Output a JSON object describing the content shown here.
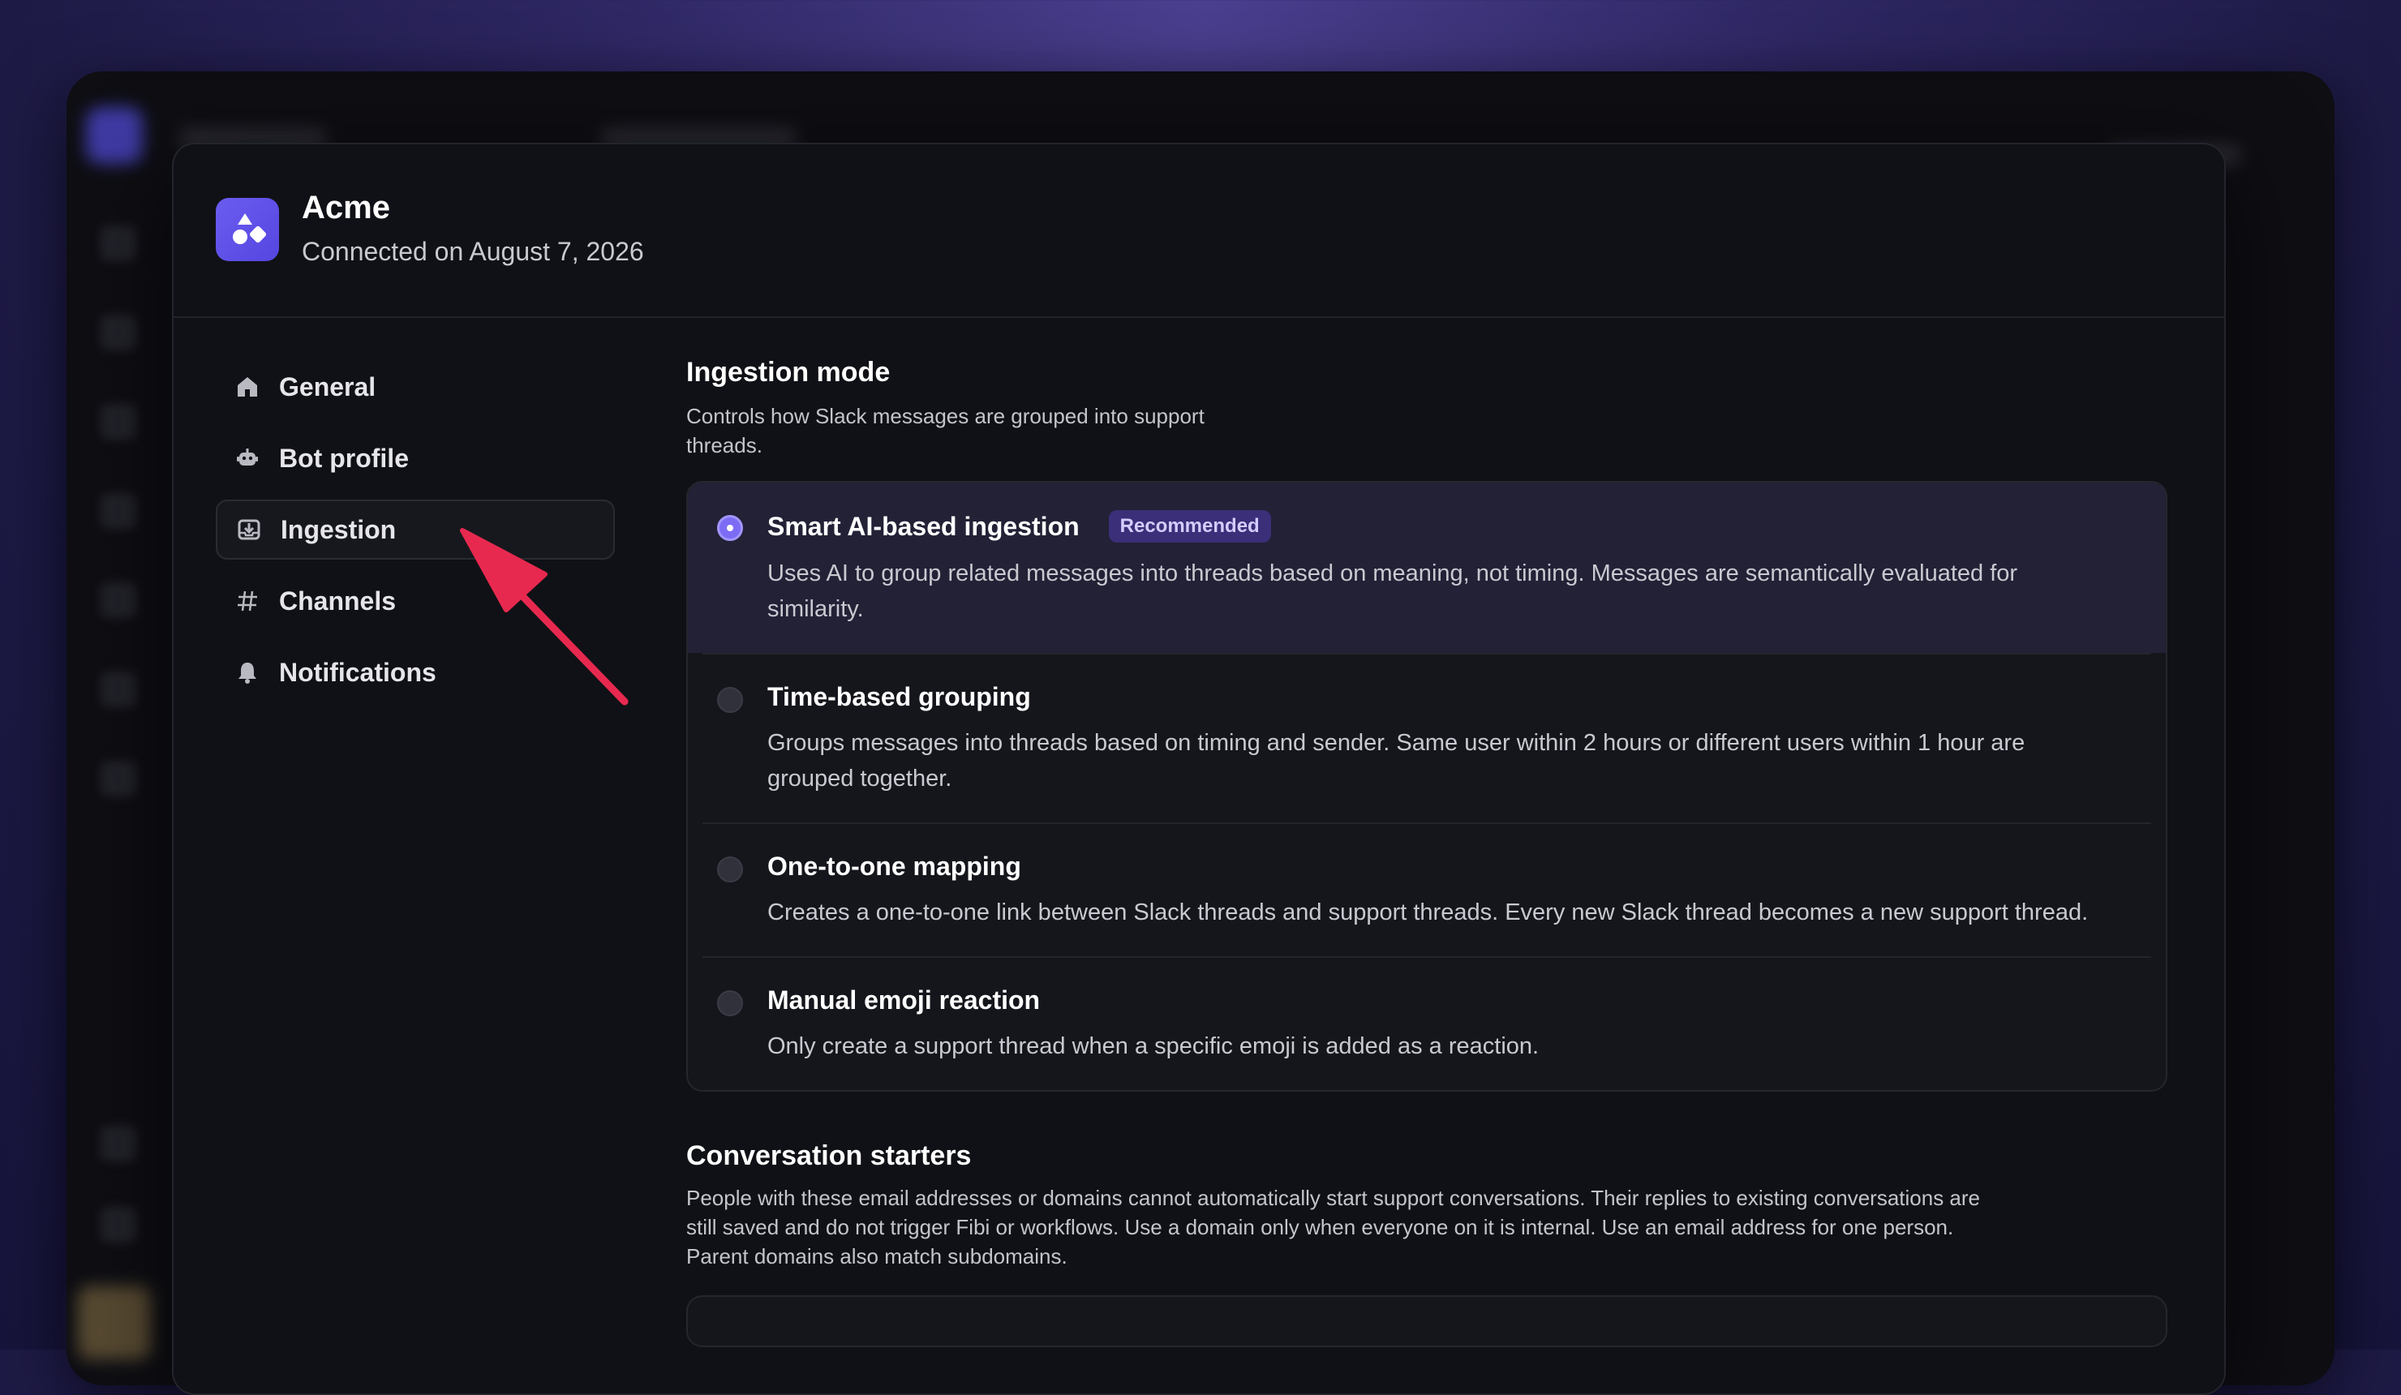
{
  "app": {
    "name": "Acme",
    "connected_text": "Connected on August 7, 2026",
    "logo_color": "#6b5cf0"
  },
  "nav": {
    "items": [
      {
        "label": "General",
        "icon": "home-icon",
        "active": false
      },
      {
        "label": "Bot profile",
        "icon": "bot-icon",
        "active": false
      },
      {
        "label": "Ingestion",
        "icon": "inbox-download-icon",
        "active": true
      },
      {
        "label": "Channels",
        "icon": "hash-icon",
        "active": false
      },
      {
        "label": "Notifications",
        "icon": "bell-icon",
        "active": false
      }
    ]
  },
  "ingestion": {
    "title": "Ingestion mode",
    "description": "Controls how Slack messages are grouped into support threads.",
    "options": [
      {
        "title": "Smart AI-based ingestion",
        "badge": "Recommended",
        "description": "Uses AI to group related messages into threads based on meaning, not timing. Messages are semantically evaluated for similarity.",
        "selected": true
      },
      {
        "title": "Time-based grouping",
        "description": "Groups messages into threads based on timing and sender. Same user within 2 hours or different users within 1 hour are grouped together.",
        "selected": false
      },
      {
        "title": "One-to-one mapping",
        "description": "Creates a one-to-one link between Slack threads and support threads. Every new Slack thread becomes a new support thread.",
        "selected": false
      },
      {
        "title": "Manual emoji reaction",
        "description": "Only create a support thread when a specific emoji is added as a reaction.",
        "selected": false
      }
    ]
  },
  "conversation_starters": {
    "title": "Conversation starters",
    "description": "People with these email addresses or domains cannot automatically start support conversations. Their replies to existing conversations are still saved and do not trigger Fibi or workflows. Use a domain only when everyone on it is internal. Use an email address for one person. Parent domains also match subdomains."
  },
  "colors": {
    "accent": "#7c6cf5",
    "badge_bg": "#3a2f78",
    "arrow": "#e8294f"
  }
}
